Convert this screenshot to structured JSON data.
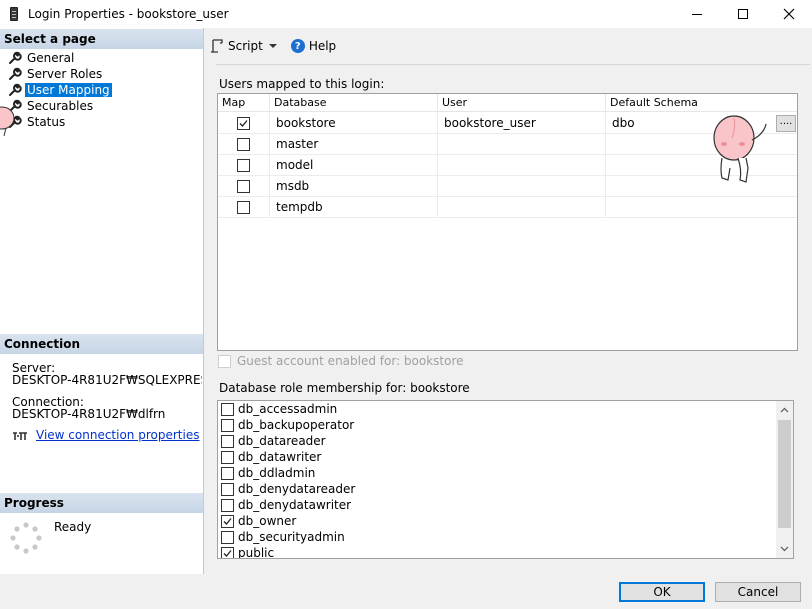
{
  "window": {
    "title": "Login Properties - bookstore_user"
  },
  "left": {
    "select_page_header": "Select a page",
    "pages": [
      {
        "label": "General"
      },
      {
        "label": "Server Roles"
      },
      {
        "label": "User Mapping"
      },
      {
        "label": "Securables"
      },
      {
        "label": "Status"
      }
    ],
    "connection_header": "Connection",
    "server_label": "Server:",
    "server_value": "DESKTOP-4R81U2F₩SQLEXPRES",
    "connection_label": "Connection:",
    "connection_value": "DESKTOP-4R81U2F₩dlfrn",
    "view_connection_link": "View connection properties",
    "progress_header": "Progress",
    "progress_status": "Ready"
  },
  "toolbar": {
    "script_label": "Script",
    "help_label": "Help"
  },
  "mapping": {
    "caption": "Users mapped to this login:",
    "columns": [
      "Map",
      "Database",
      "User",
      "Default Schema"
    ],
    "rows": [
      {
        "checked": true,
        "database": "bookstore",
        "user": "bookstore_user",
        "schema": "dbo"
      },
      {
        "checked": false,
        "database": "master",
        "user": "",
        "schema": ""
      },
      {
        "checked": false,
        "database": "model",
        "user": "",
        "schema": ""
      },
      {
        "checked": false,
        "database": "msdb",
        "user": "",
        "schema": ""
      },
      {
        "checked": false,
        "database": "tempdb",
        "user": "",
        "schema": ""
      }
    ],
    "ellipsis_label": "...."
  },
  "guest": {
    "label": "Guest account enabled for: bookstore",
    "checked": false
  },
  "roles": {
    "caption": "Database role membership for: bookstore",
    "items": [
      {
        "label": "db_accessadmin",
        "checked": false
      },
      {
        "label": "db_backupoperator",
        "checked": false
      },
      {
        "label": "db_datareader",
        "checked": false
      },
      {
        "label": "db_datawriter",
        "checked": false
      },
      {
        "label": "db_ddladmin",
        "checked": false
      },
      {
        "label": "db_denydatareader",
        "checked": false
      },
      {
        "label": "db_denydatawriter",
        "checked": false
      },
      {
        "label": "db_owner",
        "checked": true
      },
      {
        "label": "db_securityadmin",
        "checked": false
      },
      {
        "label": "public",
        "checked": true
      }
    ]
  },
  "buttons": {
    "ok": "OK",
    "cancel": "Cancel"
  },
  "colors": {
    "selection": "#0078d7",
    "link": "#0033cc",
    "header_gradient": "#c6d5e6"
  }
}
